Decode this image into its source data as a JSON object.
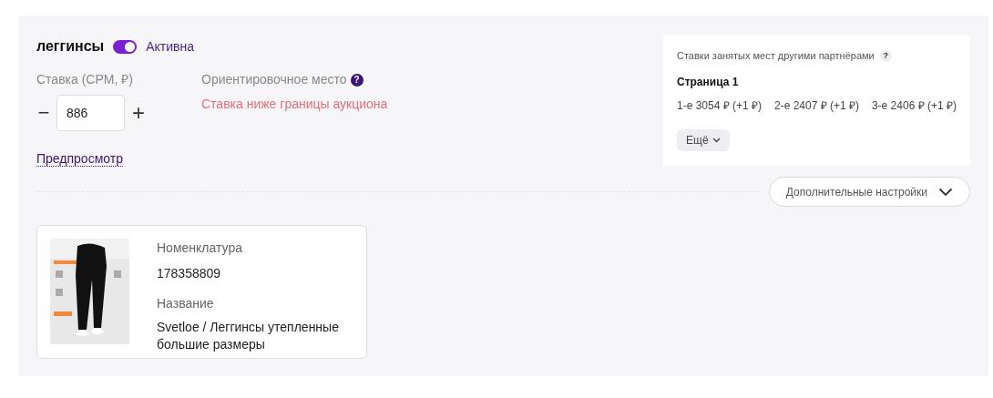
{
  "campaign": {
    "title": "леггинсы",
    "active": {
      "on": true,
      "label": "Активна"
    }
  },
  "bid": {
    "label": "Ставка (CPM, ₽)",
    "value": "886",
    "decrement": "−",
    "increment": "+"
  },
  "position": {
    "label": "Ориентировочное место",
    "help": "?",
    "warning": "Ставка ниже границы аукциона"
  },
  "preview_link": "Предпросмотр",
  "competitors": {
    "title": "Ставки занятых мест другими партнёрами",
    "help": "?",
    "page_title": "Страница 1",
    "places": [
      {
        "place": "1-е",
        "bid": "3054 ₽ (+1 ₽)"
      },
      {
        "place": "2-е",
        "bid": "2407 ₽ (+1 ₽)"
      },
      {
        "place": "3-е",
        "bid": "2406 ₽ (+1 ₽)"
      }
    ],
    "more_button": "Ещё"
  },
  "advanced_settings": "Дополнительные настройки",
  "product": {
    "sku_label": "Номенклатура",
    "sku": "178358809",
    "name_label": "Название",
    "name": "Svetloe / Леггинсы утепленные большие размеры"
  }
}
